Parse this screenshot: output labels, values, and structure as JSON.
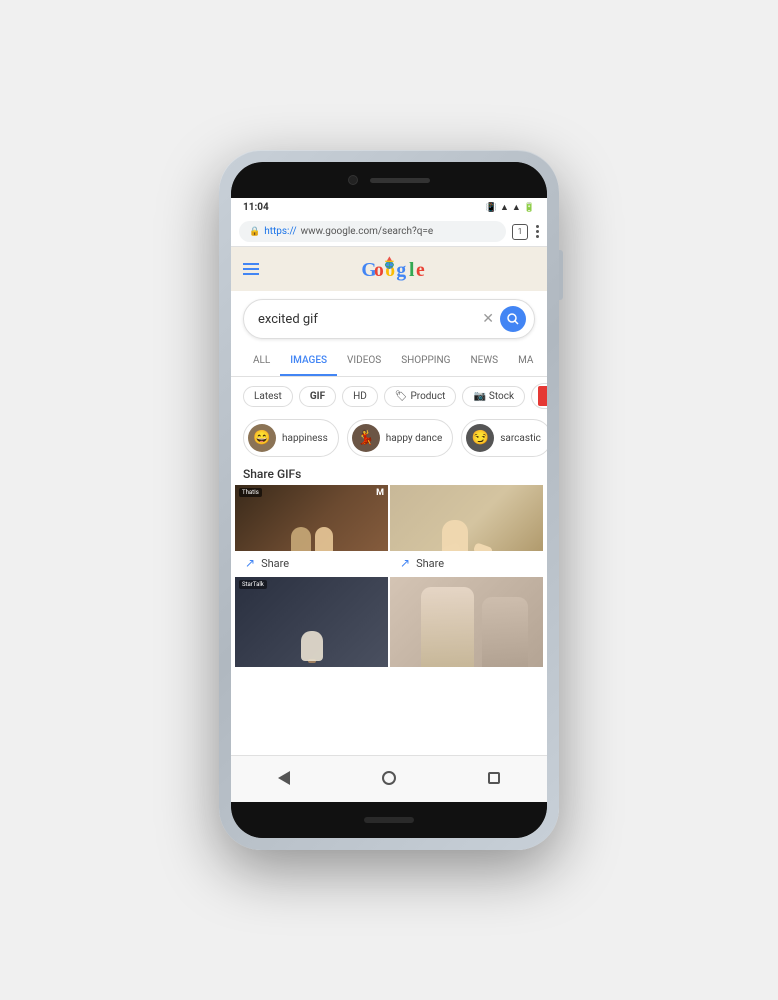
{
  "phone": {
    "status_bar": {
      "time": "11:04",
      "icons_right": "🔋📶"
    },
    "url_bar": {
      "lock_icon": "🔒",
      "url_blue": "https://",
      "url_gray": "www.google.com/search?q=e",
      "tab_count": "1"
    },
    "google": {
      "logo_alt": "Google Doodle"
    },
    "search": {
      "query": "excited gif",
      "placeholder": "Search",
      "clear_label": "×"
    },
    "nav_tabs": [
      {
        "label": "ALL",
        "active": false
      },
      {
        "label": "IMAGES",
        "active": true
      },
      {
        "label": "VIDEOS",
        "active": false
      },
      {
        "label": "SHOPPING",
        "active": false
      },
      {
        "label": "NEWS",
        "active": false
      },
      {
        "label": "MA",
        "active": false
      }
    ],
    "filter_chips": [
      {
        "label": "Latest",
        "active": false
      },
      {
        "label": "GIF",
        "active": false,
        "bold": true
      },
      {
        "label": "HD",
        "active": false
      },
      {
        "label": "Product",
        "active": false,
        "icon": "tag"
      },
      {
        "label": "Stock",
        "active": false,
        "icon": "photo"
      },
      {
        "label": "",
        "active": false,
        "color": true
      }
    ],
    "suggestion_chips": [
      {
        "label": "happiness",
        "avatar_color": "#8b7355"
      },
      {
        "label": "happy dance",
        "avatar_color": "#6b5545"
      },
      {
        "label": "sarcastic",
        "avatar_color": "#555"
      }
    ],
    "section_title": "Share GIFs",
    "gif_items": [
      {
        "source": "ThatIs",
        "icon": "M",
        "has_share": true,
        "share_label": "Share",
        "bg": "dark-warm"
      },
      {
        "source": "",
        "icon": "",
        "has_share": true,
        "share_label": "Share",
        "bg": "light-warm"
      },
      {
        "source": "StarTalk",
        "icon": "",
        "has_share": false,
        "bg": "dark-cool"
      },
      {
        "source": "",
        "icon": "",
        "has_share": false,
        "bg": "light-neutral"
      }
    ],
    "bottom_nav": {
      "back_label": "◀",
      "home_label": "⬤",
      "recent_label": "■"
    }
  }
}
